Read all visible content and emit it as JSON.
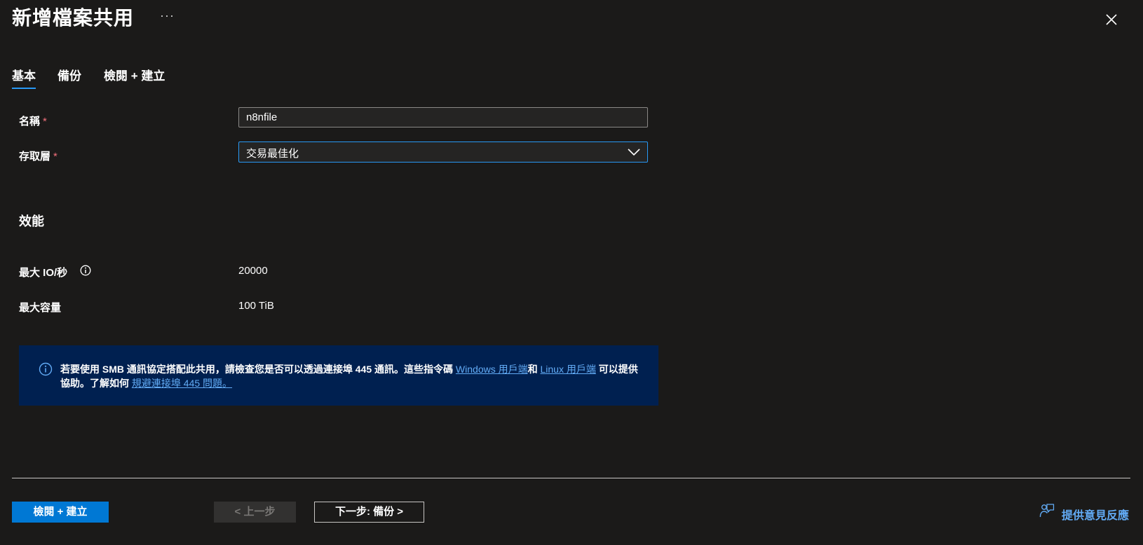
{
  "header": {
    "title": "新增檔案共用",
    "more_label": "···"
  },
  "tabs": [
    {
      "label": "基本",
      "active": true
    },
    {
      "label": "備份",
      "active": false
    },
    {
      "label": "檢閱 + 建立",
      "active": false
    }
  ],
  "form": {
    "name": {
      "label": "名稱",
      "required_mark": "*",
      "value": "n8nfile"
    },
    "access_tier": {
      "label": "存取層",
      "required_mark": "*",
      "value": "交易最佳化"
    }
  },
  "performance": {
    "section_title": "效能",
    "max_iops": {
      "label": "最大 IO/秒",
      "value": "20000"
    },
    "max_capacity": {
      "label": "最大容量",
      "value": "100 TiB"
    }
  },
  "banner": {
    "text_1": "若要使用 SMB 通訊協定搭配此共用，請檢查您是否可以透過連接埠 445 通訊。這些指令碼 ",
    "link_windows": "Windows 用戶端",
    "text_2": "和 ",
    "link_linux": "Linux 用戶端",
    "text_3": " 可以提供協助。了解如何 ",
    "link_troubleshoot": "規避連接埠 445 問題。"
  },
  "footer": {
    "review_create_label": "檢閱 + 建立",
    "previous_label": "< 上一步",
    "next_label": "下一步: 備份 >",
    "feedback_label": "提供意見反應"
  },
  "colors": {
    "background": "#1b1a19",
    "accent": "#0078d4",
    "tab_underline": "#2899f5",
    "link": "#62abf5",
    "banner_bg": "#002050",
    "required": "#f1707b"
  }
}
